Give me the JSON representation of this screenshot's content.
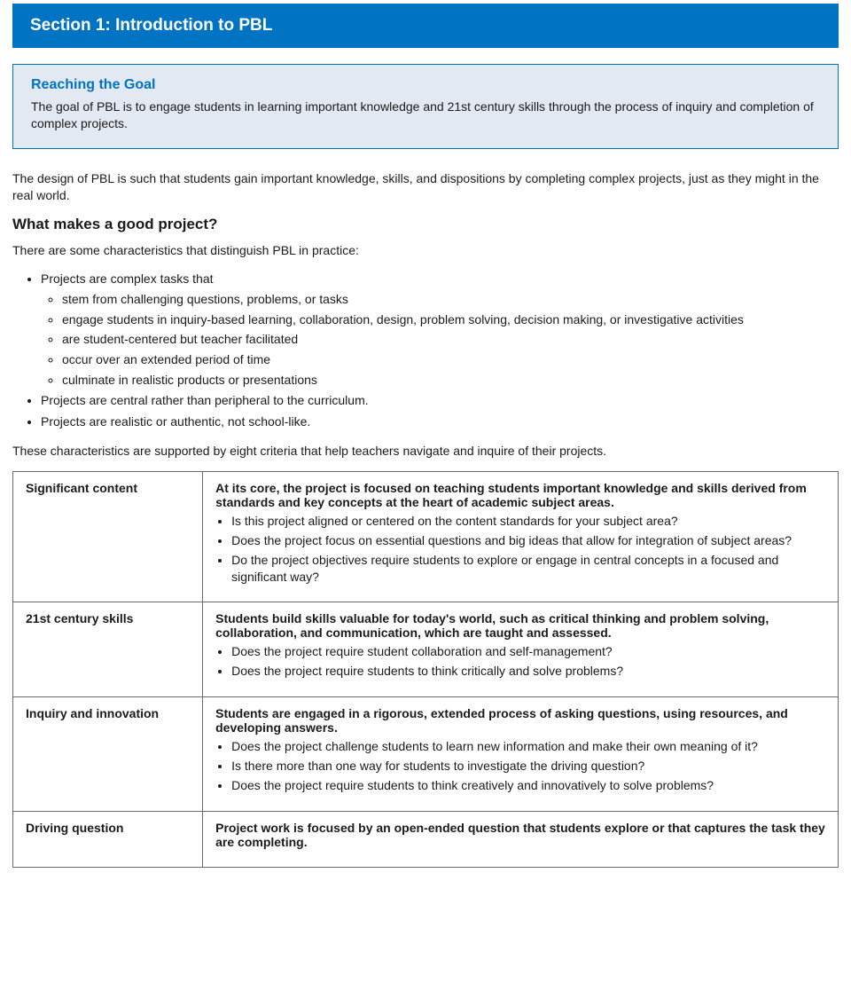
{
  "title_bar": "Section 1: Introduction to PBL",
  "reaching_goal": {
    "heading": "Reaching the Goal",
    "body": "The goal of PBL is to engage students in learning important knowledge and 21st century skills through the process of inquiry and completion of complex projects."
  },
  "p_after_box": "The design of PBL is such that students gain important knowledge, skills, and dispositions by completing complex projects, just as they might in the real world.",
  "good_project_heading": "What makes a good project?",
  "good_project_intro": "There are some characteristics that distinguish PBL in practice:",
  "good_project_bullets": [
    "Projects are complex tasks that",
    [
      "stem from challenging questions, problems, or tasks",
      "engage students in inquiry-based learning, collaboration, design, problem solving, decision making, or investigative activities",
      "are student-centered but teacher facilitated",
      "occur over an extended period of time",
      "culminate in realistic products or presentations"
    ],
    "Projects are central rather than peripheral to the curriculum.",
    "Projects are realistic or authentic, not school-like."
  ],
  "good_project_postnote": "These characteristics are supported by eight criteria that help teachers navigate and inquire of their projects.",
  "rubric": [
    {
      "left_title": "Significant content",
      "right_title": "At its core, the project is focused on teaching students important knowledge and skills derived from standards and key concepts at the heart of academic subject areas.",
      "right_bullets": [
        "Is this project aligned or centered on the content standards for your subject area?",
        "Does the project focus on essential questions and big ideas that allow for integration of subject areas?",
        "Do the project objectives require students to explore or engage in central concepts in a focused and significant way?"
      ]
    },
    {
      "left_title": "21st century skills",
      "right_title": "Students build skills valuable for today's world, such as critical thinking and problem solving, collaboration, and communication, which are taught and assessed.",
      "right_bullets": [
        "Does the project require student collaboration and self-management?",
        "Does the project require students to think critically and solve problems?"
      ]
    },
    {
      "left_title": "Inquiry and innovation",
      "right_title": "Students are engaged in a rigorous, extended process of asking questions, using resources, and developing answers.",
      "right_bullets": [
        "Does the project challenge students to learn new information and make their own meaning of it?",
        "Is there more than one way for students to investigate the driving question?",
        "Does the project require students to think creatively and innovatively to solve problems?"
      ]
    },
    {
      "left_title": "Driving question",
      "right_title": "Project work is focused by an open-ended question that students explore or that captures the task they are completing.",
      "right_bullets": []
    }
  ]
}
